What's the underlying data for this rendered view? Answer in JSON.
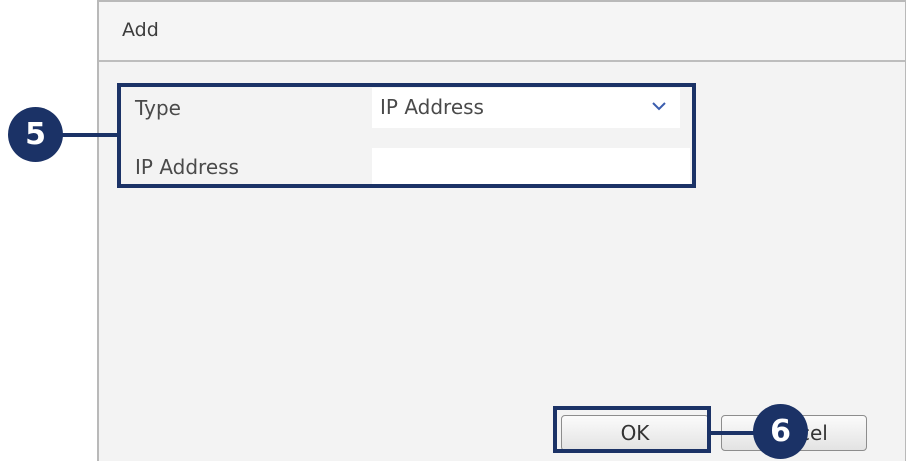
{
  "dialog": {
    "title": "Add",
    "fields": {
      "type_label": "Type",
      "type_value": "IP Address",
      "ip_label": "IP Address",
      "ip_value": ""
    },
    "buttons": {
      "ok_label": "OK",
      "cancel_label": "Cancel"
    }
  },
  "callouts": {
    "step_5": "5",
    "step_6": "6"
  },
  "icons": {
    "dropdown": "chevron-down-icon"
  },
  "colors": {
    "callout": "#1b3266",
    "dialog_bg": "#f3f3f3",
    "chevron": "#3a5dae"
  }
}
